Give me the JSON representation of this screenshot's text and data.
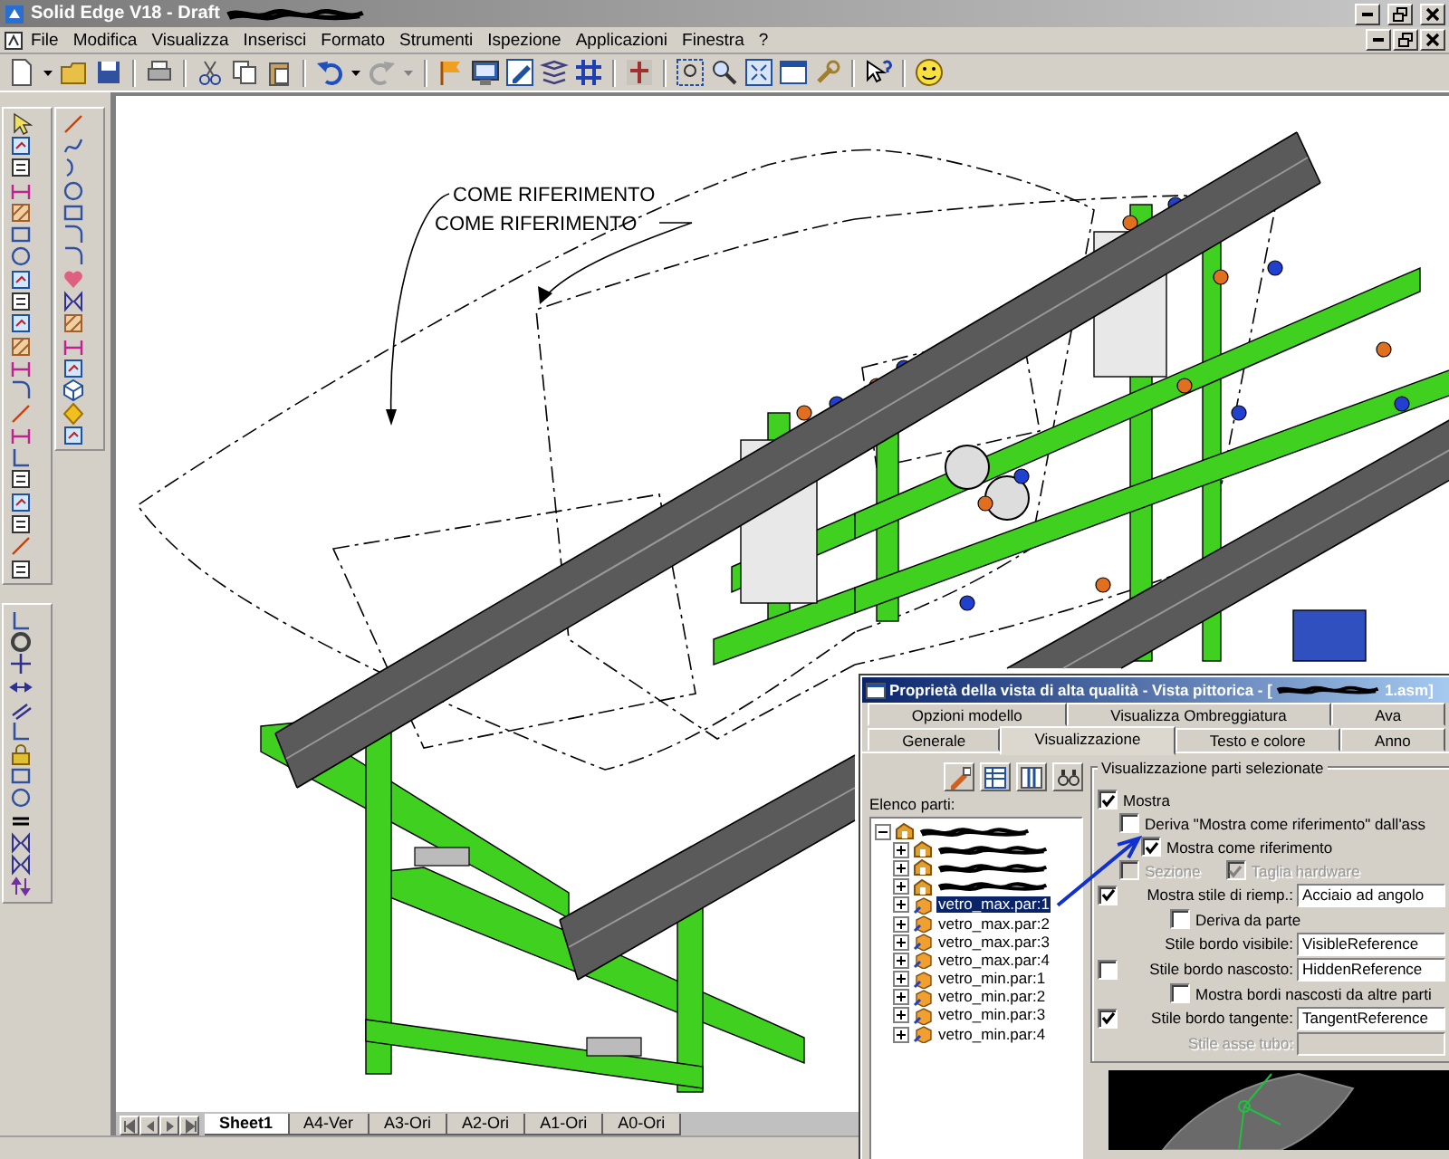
{
  "window": {
    "title": "Solid Edge V18 - Draft"
  },
  "menu": [
    "File",
    "Modifica",
    "Visualizza",
    "Inserisci",
    "Formato",
    "Strumenti",
    "Ispezione",
    "Applicazioni",
    "Finestra",
    "?"
  ],
  "drawing": {
    "labels": [
      "COME RIFERIMENTO",
      "COME RIFERIMENTO"
    ]
  },
  "sheet_tabs": [
    {
      "label": "Sheet1",
      "selected": true
    },
    {
      "label": "A4-Ver",
      "selected": false
    },
    {
      "label": "A3-Ori",
      "selected": false
    },
    {
      "label": "A2-Ori",
      "selected": false
    },
    {
      "label": "A1-Ori",
      "selected": false
    },
    {
      "label": "A0-Ori",
      "selected": false
    }
  ],
  "dialog": {
    "title_start": "Proprietà della vista di alta qualità - Vista pittorica - [",
    "title_end": "1.asm]",
    "tabs_back": [
      {
        "label": "Opzioni modello",
        "selected": false
      },
      {
        "label": "Visualizza Ombreggiatura",
        "selected": false
      },
      {
        "label": "Ava",
        "selected": false
      }
    ],
    "tabs_front": [
      {
        "label": "Generale",
        "selected": false
      },
      {
        "label": "Visualizzazione",
        "selected": true
      },
      {
        "label": "Testo e colore",
        "selected": false
      },
      {
        "label": "Anno",
        "selected": false
      }
    ],
    "parts_label": "Elenco parti:",
    "parts": [
      {
        "kind": "hidden",
        "expanded": true,
        "selected": false,
        "children": [
          {
            "kind": "hidden",
            "expanded": false,
            "selected": false
          },
          {
            "kind": "hidden",
            "expanded": false,
            "selected": false
          },
          {
            "kind": "hidden",
            "expanded": false,
            "selected": false
          },
          {
            "kind": "part",
            "label": "vetro_max.par:1",
            "expanded": false,
            "selected": true
          },
          {
            "kind": "part",
            "label": "vetro_max.par:2",
            "expanded": false,
            "selected": false
          },
          {
            "kind": "part",
            "label": "vetro_max.par:3",
            "expanded": false,
            "selected": false
          },
          {
            "kind": "part",
            "label": "vetro_max.par:4",
            "expanded": false,
            "selected": false
          },
          {
            "kind": "part",
            "label": "vetro_min.par:1",
            "expanded": false,
            "selected": false
          },
          {
            "kind": "part",
            "label": "vetro_min.par:2",
            "expanded": false,
            "selected": false
          },
          {
            "kind": "part",
            "label": "vetro_min.par:3",
            "expanded": false,
            "selected": false
          },
          {
            "kind": "part",
            "label": "vetro_min.par:4",
            "expanded": false,
            "selected": false
          }
        ]
      }
    ],
    "group_title": "Visualizzazione parti selezionate",
    "options": [
      {
        "kind": "check",
        "label": "Mostra",
        "checked": true,
        "disabled": false,
        "children": [
          {
            "kind": "check",
            "label": "Deriva \"Mostra come riferimento\" dall'ass",
            "checked": false,
            "disabled": false,
            "children": [
              {
                "kind": "check",
                "label": "Mostra come riferimento",
                "checked": true,
                "disabled": false
              }
            ]
          },
          {
            "kind": "pair",
            "items": [
              {
                "label": "Sezione",
                "checked": false,
                "disabled": true
              },
              {
                "label": "Taglia hardware",
                "checked": true,
                "disabled": true
              }
            ]
          }
        ]
      },
      {
        "kind": "field",
        "label": "Mostra stile di riemp.:",
        "checked": true,
        "disabled": false,
        "value": "Acciaio ad angolo",
        "children": [
          {
            "kind": "check",
            "label": "Deriva da parte",
            "checked": false,
            "disabled": false
          }
        ]
      },
      {
        "kind": "field",
        "label": "Stile bordo visibile:",
        "disabled": false,
        "value": "VisibleReference"
      },
      {
        "kind": "field",
        "label": "Stile bordo nascosto:",
        "checked": false,
        "disabled": false,
        "value": "HiddenReference",
        "children": [
          {
            "kind": "check",
            "label": "Mostra bordi nascosti da altre parti",
            "checked": false,
            "disabled": false
          }
        ]
      },
      {
        "kind": "field",
        "label": "Stile bordo tangente:",
        "checked": true,
        "disabled": false,
        "value": "TangentReference"
      },
      {
        "kind": "field",
        "label": "Stile asse tubo:",
        "disabled": true
      }
    ]
  }
}
